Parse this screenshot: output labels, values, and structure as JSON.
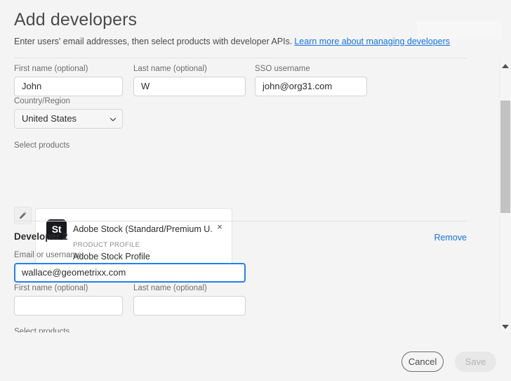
{
  "header": {
    "title": "Add developers",
    "subtitle_text": "Enter users' email addresses, then select products with developer APIs.",
    "link_text": "Learn more about managing developers"
  },
  "developer1": {
    "fields": {
      "first_name_label": "First name (optional)",
      "first_name_value": "John",
      "last_name_label": "Last name (optional)",
      "last_name_value": "W",
      "sso_username_label": "SSO username",
      "sso_username_value": "john@org31.com",
      "country_label": "Country/Region",
      "country_value": "United States"
    },
    "products": {
      "section_label": "Select products",
      "edit_icon": "pencil-icon",
      "card": {
        "icon_text": "St",
        "icon_name": "adobe-stock-icon",
        "name": "Adobe Stock (Standard/Premium U...",
        "close_glyph": "×",
        "profile_label": "PRODUCT PROFILE",
        "profile_value": "Adobe Stock Profile"
      }
    }
  },
  "developer2": {
    "title": "Developer 2",
    "remove_label": "Remove",
    "fields": {
      "email_label": "Email or username",
      "email_value": "wallace@geometrixx.com",
      "first_name_label": "First name (optional)",
      "first_name_value": "",
      "last_name_label": "Last name (optional)",
      "last_name_value": ""
    },
    "products_label": "Select products"
  },
  "footer": {
    "cancel_label": "Cancel",
    "save_label": "Save"
  },
  "scrollbar": {
    "up_icon": "chevron-up-icon",
    "down_icon": "chevron-down-icon"
  },
  "colors": {
    "background": "#f4f4f4",
    "link": "#1473e6",
    "focus_border": "#2680eb",
    "text_primary": "#2c2c2c",
    "text_secondary": "#6e6e6e",
    "product_icon_bg": "#18191d",
    "scroll_thumb": "#c2c2c2"
  }
}
